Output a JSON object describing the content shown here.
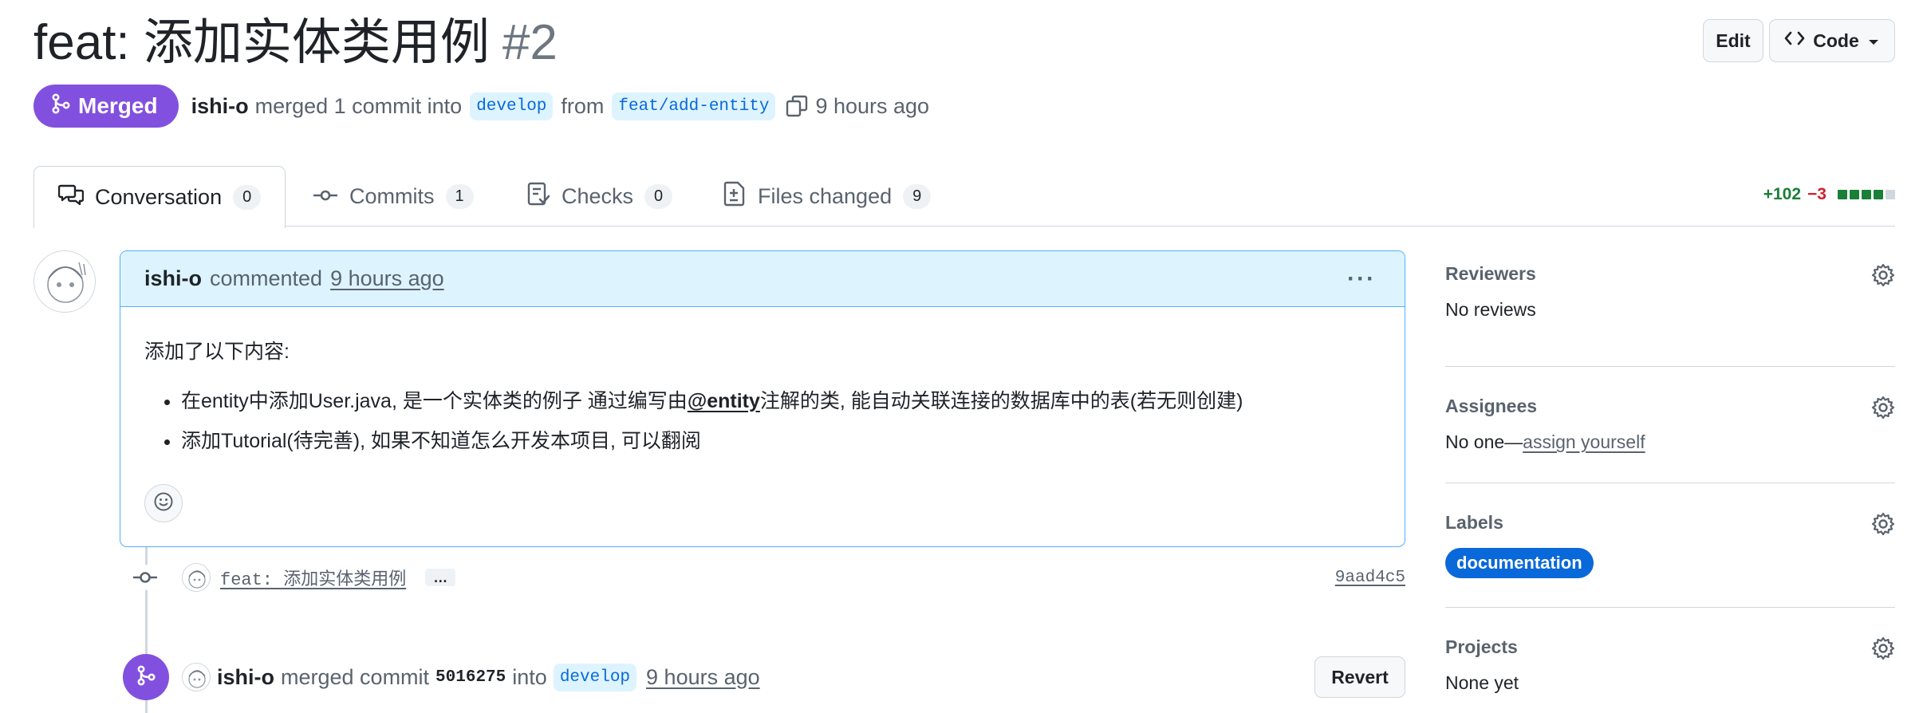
{
  "header": {
    "title": "feat: 添加实体类用例",
    "number": "#2",
    "edit_label": "Edit",
    "code_label": "Code"
  },
  "meta": {
    "state": "Merged",
    "author": "ishi-o",
    "action": "merged 1 commit into",
    "base_branch": "develop",
    "from": "from",
    "head_branch": "feat/add-entity",
    "time": "9 hours ago"
  },
  "tabs": [
    {
      "label": "Conversation",
      "count": "0"
    },
    {
      "label": "Commits",
      "count": "1"
    },
    {
      "label": "Checks",
      "count": "0"
    },
    {
      "label": "Files changed",
      "count": "9"
    }
  ],
  "diffstat": {
    "additions": "+102",
    "deletions": "−3"
  },
  "comment": {
    "author": "ishi-o",
    "action": "commented",
    "time": "9 hours ago",
    "intro": "添加了以下内容:",
    "item1_before": "在entity中添加User.java, 是一个实体类的例子 通过编写由",
    "item1_mention": "@entity",
    "item1_after": "注解的类, 能自动关联连接的数据库中的表(若无则创建)",
    "item2": "添加Tutorial(待完善), 如果不知道怎么开发本项目, 可以翻阅"
  },
  "commit": {
    "message": "feat: 添加实体类用例",
    "ellipsis": "…",
    "sha": "9aad4c5"
  },
  "merge_event": {
    "author": "ishi-o",
    "action": "merged commit",
    "sha": "5016275",
    "into": "into",
    "branch": "develop",
    "time": "9 hours ago",
    "revert_label": "Revert"
  },
  "sidebar": {
    "reviewers": {
      "title": "Reviewers",
      "value": "No reviews"
    },
    "assignees": {
      "title": "Assignees",
      "value": "No one—",
      "link": "assign yourself"
    },
    "labels": {
      "title": "Labels",
      "label": "documentation"
    },
    "projects": {
      "title": "Projects",
      "value": "None yet"
    }
  },
  "colors": {
    "merged": "#8250df",
    "accent": "#0969da",
    "comment_header": "#ddf4ff",
    "add": "#1a7f37",
    "delete": "#cf222e"
  },
  "icons": [
    "git-merge-icon",
    "copy-icon",
    "comment-discussion-icon",
    "git-commit-icon",
    "checklist-icon",
    "file-diff-icon",
    "kebab-horizontal-icon",
    "smiley-icon",
    "gear-icon",
    "code-icon",
    "triangle-down-icon"
  ]
}
